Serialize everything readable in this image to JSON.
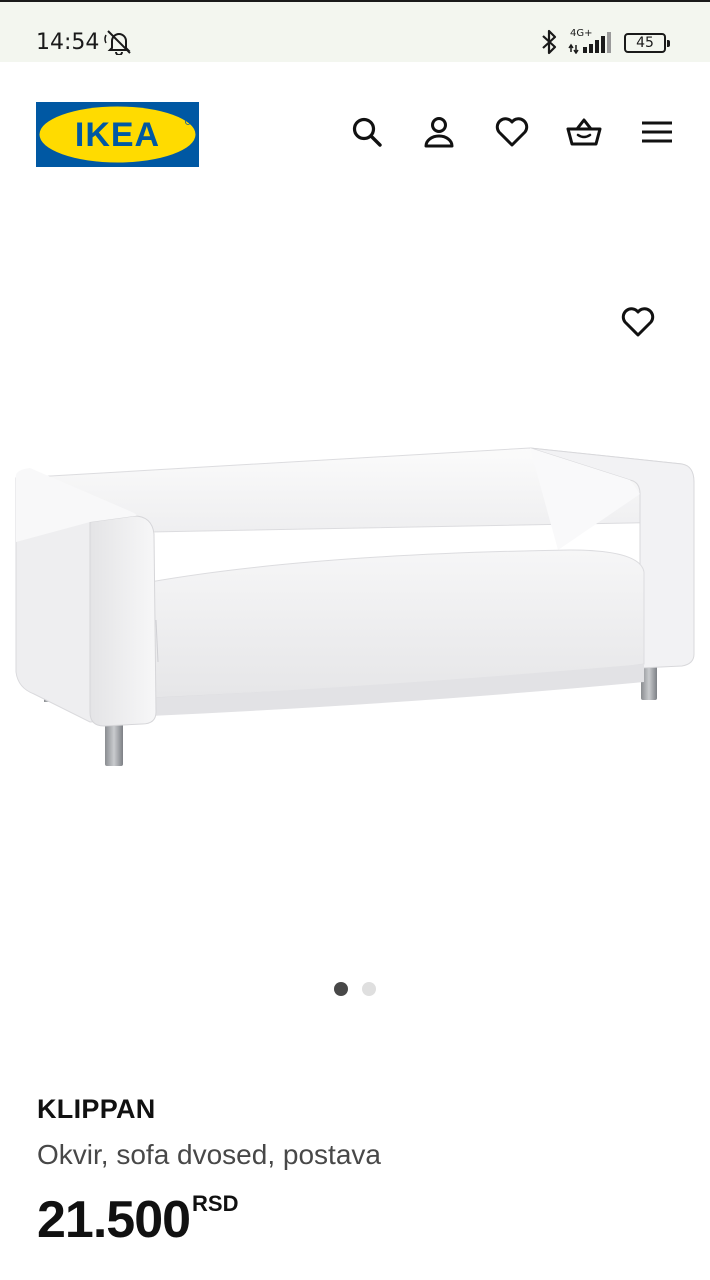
{
  "status_bar": {
    "time": "14:54",
    "network": "4G+",
    "battery": "45"
  },
  "header": {
    "logo_text": "IKEA",
    "icons": [
      "search-icon",
      "profile-icon",
      "heart-icon",
      "cart-icon",
      "menu-icon"
    ]
  },
  "gallery": {
    "image_count": 2,
    "active_index": 0
  },
  "product": {
    "name": "KLIPPAN",
    "description": "Okvir, sofa dvosed, postava",
    "price": "21.500",
    "currency": "RSD"
  },
  "colors": {
    "ikea_blue": "#0058a3",
    "ikea_yellow": "#ffdb00",
    "status_bg": "#f3f6ef"
  }
}
